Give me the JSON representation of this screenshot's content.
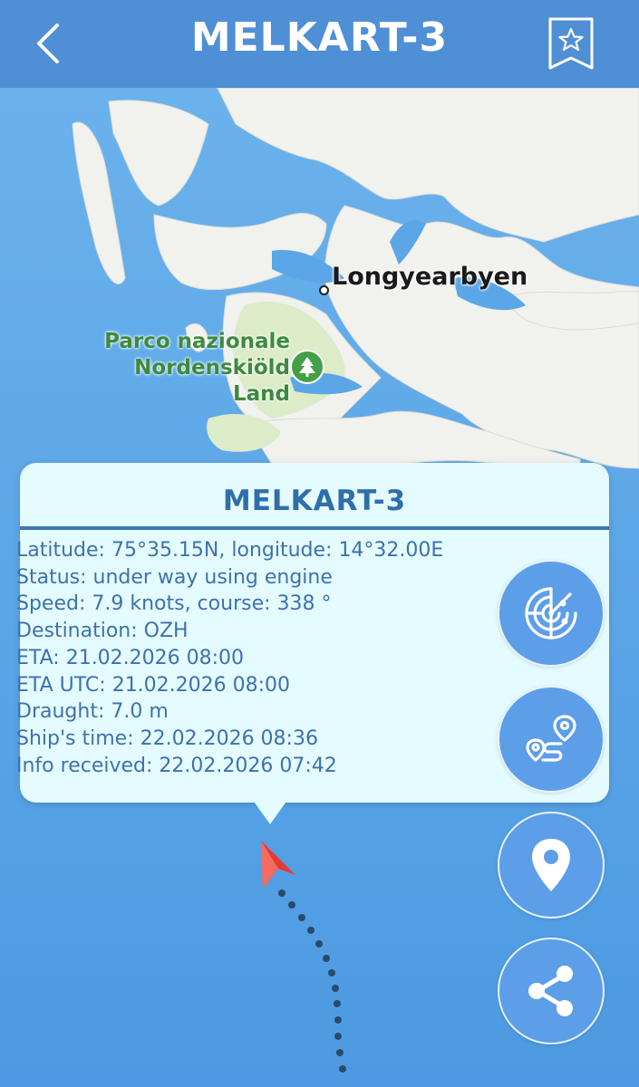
{
  "header": {
    "title": "MELKART-3",
    "back_icon": "chevron-left-icon",
    "favorite_icon": "bookmark-star-icon"
  },
  "map": {
    "city_label": "Longyearbyen",
    "park_label_lines": [
      "Parco nazionale",
      "Nordenskiöld",
      "Land"
    ],
    "park_icon": "tree-icon",
    "ship_marker_icon": "ship-arrow-icon"
  },
  "card": {
    "title": "MELKART-3",
    "lines": [
      "Latitude: 75°35.15N, longitude: 14°32.00E",
      "Status: under way using engine",
      "Speed: 7.9 knots, course: 338 °",
      "Destination: OZH",
      "ETA: 21.02.2026 08:00",
      "ETA UTC: 21.02.2026 08:00",
      "Draught: 7.0 m",
      "Ship's time: 22.02.2026 08:36",
      "Info received: 22.02.2026 07:42"
    ]
  },
  "actions": [
    {
      "name": "radar-button",
      "icon": "radar-icon"
    },
    {
      "name": "route-button",
      "icon": "route-icon"
    },
    {
      "name": "location-button",
      "icon": "map-pin-icon"
    },
    {
      "name": "share-button",
      "icon": "share-icon"
    }
  ],
  "colors": {
    "header_bg": "#4f8fd6",
    "sea": "#5aa6e6",
    "land": "#f1f1ee",
    "park": "#dcebc8",
    "card_bg": "#e4fbff",
    "card_text": "#3c72ad",
    "button_bg": "#5d9ee8",
    "ship_marker": "#e53935"
  }
}
